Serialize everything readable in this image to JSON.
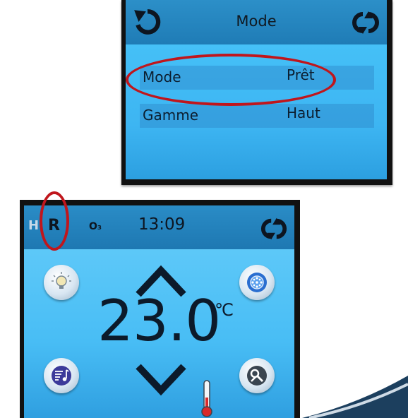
{
  "mode_screen": {
    "title": "Mode",
    "rows": [
      {
        "label": "Mode",
        "value": "Prêt"
      },
      {
        "label": "Gamme",
        "value": "Haut"
      }
    ],
    "icons": {
      "back": "back-arrow-icon",
      "sync": "sync-icon"
    }
  },
  "main_screen": {
    "status": {
      "h": "H",
      "r": "R",
      "o3": "O₃"
    },
    "time": "13:09",
    "temperature": "23.0",
    "unit": "℃",
    "icons": {
      "light": "light-bulb-icon",
      "jets": "jets-icon",
      "music": "music-icon",
      "settings": "settings-icon",
      "up": "arrow-up-icon",
      "down": "arrow-down-icon",
      "thermometer": "thermometer-icon",
      "sync": "sync-icon"
    }
  },
  "colors": {
    "screen_blue": "#3db6f3",
    "header_blue": "#1f7cb6",
    "highlight_red": "#c0161c"
  }
}
